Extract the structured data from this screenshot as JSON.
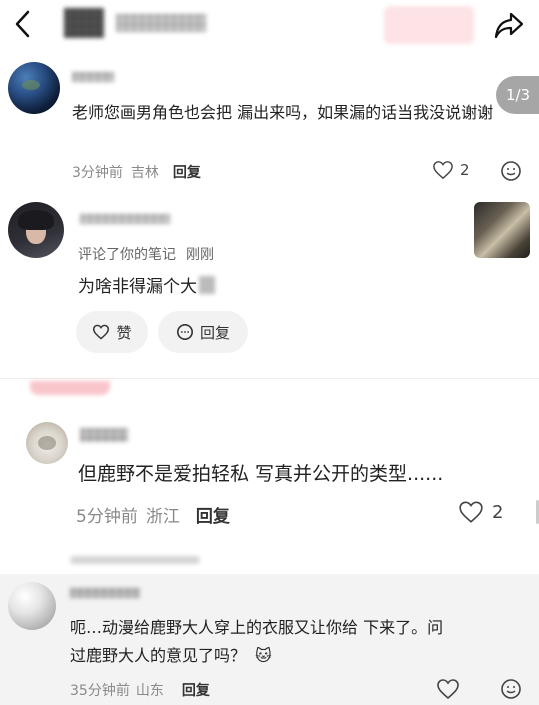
{
  "header": {
    "back_icon": "chevron-left-icon",
    "share_icon": "share-arrow-icon"
  },
  "note_badge": "1/3",
  "comment1": {
    "avatar": "earth-avatar",
    "text": "老师您画男角色也会把  漏出来吗，如果漏的话当我没说谢谢",
    "time": "3分钟前",
    "location": "吉林",
    "reply_label": "回复",
    "like_count": "2"
  },
  "notification": {
    "subtitle_prefix": "评论了你的笔记",
    "subtitle_time": "刚刚",
    "text": "为啥非得漏个大",
    "like_label": "赞",
    "reply_label": "回复"
  },
  "comment2": {
    "text": "但鹿野不是爱拍轻私  写真并公开的类型......",
    "time": "5分钟前",
    "location": "浙江",
    "reply_label": "回复",
    "like_count": "2"
  },
  "comment3": {
    "text_line1": "呃…动漫给鹿野大人穿上的衣服又让你给  下来了。问",
    "text_line2": "过鹿野大人的意见了吗？",
    "emoji": "🐱",
    "time": "35分钟前",
    "location": "山东",
    "reply_label": "回复"
  },
  "colors": {
    "gray_bg": "#f3f3f3",
    "tag_red": "#f7a7b2",
    "meta_text": "#8a8a8a"
  }
}
